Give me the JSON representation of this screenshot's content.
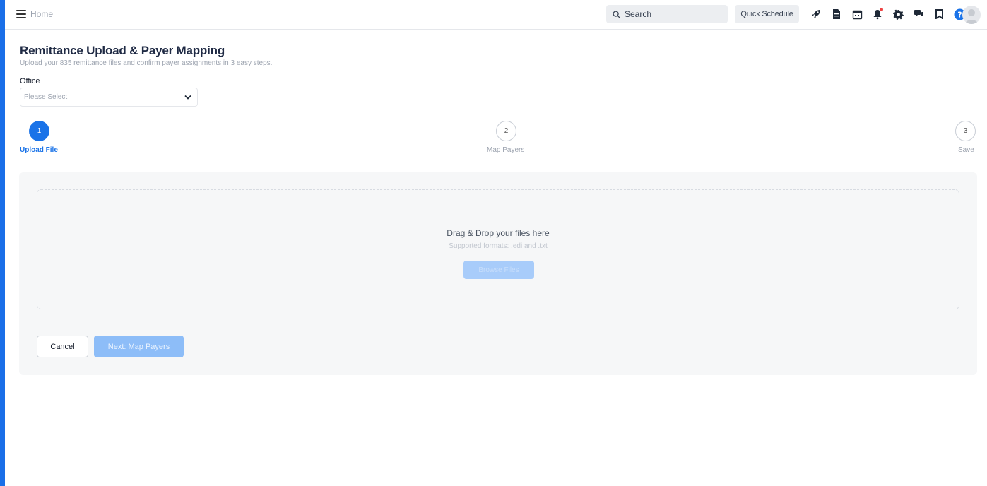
{
  "topbar": {
    "home_label": "Home",
    "search_label": "Search",
    "quick_schedule_label": "Quick Schedule",
    "icons": [
      "rocket-icon",
      "document-icon",
      "calendar-icon",
      "bell-icon",
      "gear-icon",
      "chat-icon",
      "bookmark-icon",
      "help-icon"
    ],
    "accent_color": "#1a73e8",
    "notification_color": "#ef4444"
  },
  "page": {
    "title": "Remittance Upload & Payer Mapping",
    "subtitle": "Upload your 835 remittance files and confirm payer assignments in 3 easy steps."
  },
  "office": {
    "label": "Office",
    "selected": "Please Select"
  },
  "steps": [
    {
      "number": "1",
      "label": "Upload File",
      "active": true
    },
    {
      "number": "2",
      "label": "Map Payers",
      "active": false
    },
    {
      "number": "3",
      "label": "Save",
      "active": false
    }
  ],
  "upload": {
    "title": "Drag & Drop your files here",
    "formats": "Supported formats: .edi and .txt",
    "browse_label": "Browse Files"
  },
  "actions": {
    "cancel_label": "Cancel",
    "next_label": "Next: Map Payers"
  }
}
